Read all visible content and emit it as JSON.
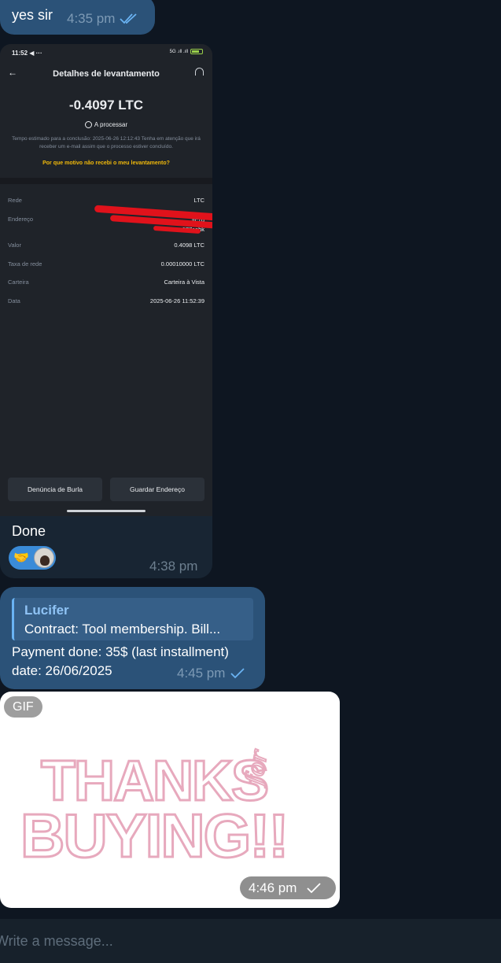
{
  "colors": {
    "background": "#0e1621",
    "outgoing_bubble": "#2b5278",
    "incoming_bubble": "#182533",
    "accent": "#6ab3f3",
    "binance_yellow": "#f0b90b"
  },
  "messages": [
    {
      "text": "yes sir",
      "time": "4:35 pm",
      "status_icon": "double-check-icon"
    },
    {
      "attachment": {
        "status_bar": {
          "time": "11:52",
          "extra": "◀ ···",
          "signal": "5G .ıll .ıll"
        },
        "title": "Detalhes de levantamento",
        "amount": "-0.4097 LTC",
        "status": "A processar",
        "note": "Tempo estimado para a conclusão: 2025-06-26 12:12:43 Tenha em atenção que irá receber um e-mail assim que o processo estiver concluído.",
        "link": "Por que motivo não recebi o meu levantamento?",
        "rows": [
          {
            "label": "Rede",
            "value": "LTC"
          },
          {
            "label": "Endereço",
            "value": "ltc1q ... ma977cahk"
          },
          {
            "label": "Valor",
            "value": "0.4098 LTC"
          },
          {
            "label": "Taxa de rede",
            "value": "0.00010000 LTC"
          },
          {
            "label": "Carteira",
            "value": "Carteira à Vista"
          },
          {
            "label": "Data",
            "value": "2025-06-26 11:52:39"
          }
        ],
        "address_line1": "ltc1q",
        "address_line2": "ma977cahk",
        "buttons": [
          "Denúncia de Burla",
          "Guardar Endereço"
        ]
      },
      "text": "Done",
      "reaction": "🤝",
      "time": "4:38 pm"
    },
    {
      "reply": {
        "name": "Lucifer",
        "snippet": "Contract: Tool membership. Bill..."
      },
      "line1": "Payment done: 35$ (last installment)",
      "line2": "date: 26/06/2025",
      "time": "4:45 pm",
      "status_icon": "check-icon"
    },
    {
      "gif_badge": "GIF",
      "gif_text_1": "THANKS",
      "gif_text_2": "for",
      "gif_text_3": "BUYING!!",
      "time": "4:46 pm",
      "status_icon": "check-icon"
    }
  ],
  "composer": {
    "placeholder": "Write a message..."
  }
}
